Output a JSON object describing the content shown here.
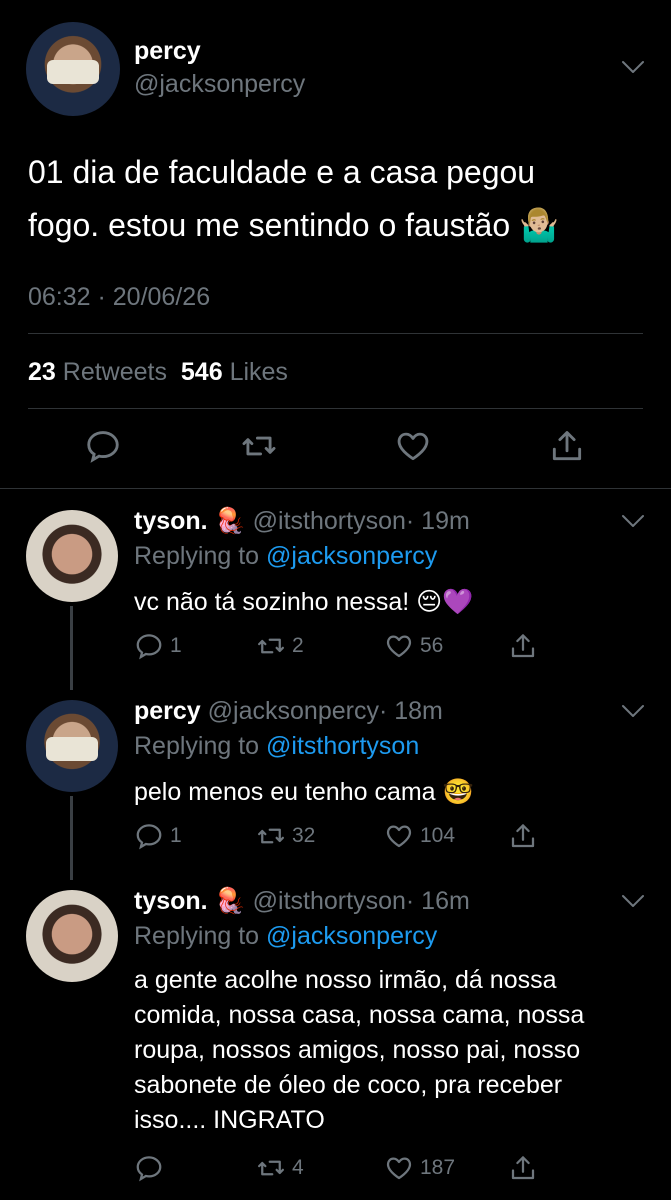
{
  "tweet": {
    "display_name": "percy",
    "handle": "@jacksonpercy",
    "text_line1": "01 dia de faculdade e a casa pegou",
    "text_line2": "fogo. estou me sentindo o faustão",
    "emoji": "🤷🏼‍♂️",
    "timestamp": "06:32 · 20/06/26",
    "retweets_count": "23",
    "retweets_label": "Retweets",
    "likes_count": "546",
    "likes_label": "Likes"
  },
  "replies": [
    {
      "display_name": "tyson.",
      "badge_emoji": "🪼",
      "handle": "@itsthortyson",
      "time": "· 19m",
      "replying_prefix": "Replying to",
      "replying_to": "@jacksonpercy",
      "text": "vc não tá sozinho nessa! 😔💜",
      "replies": "1",
      "retweets": "2",
      "likes": "56"
    },
    {
      "display_name": "percy",
      "handle": "@jacksonpercy",
      "time": "· 18m",
      "replying_prefix": "Replying to",
      "replying_to": "@itsthortyson",
      "text": "pelo menos eu tenho cama 🤓",
      "replies": "1",
      "retweets": "32",
      "likes": "104"
    },
    {
      "display_name": "tyson.",
      "badge_emoji": "🪼",
      "handle": "@itsthortyson",
      "time": "· 16m",
      "replying_prefix": "Replying to",
      "replying_to": "@jacksonpercy",
      "text_lines": [
        "a gente acolhe nosso irmão, dá nossa",
        "comida, nossa casa, nossa cama, nossa",
        "roupa, nossos amigos, nosso pai, nosso",
        "sabonete de óleo de coco, pra receber",
        "isso.... INGRATO"
      ],
      "replies": "",
      "retweets": "4",
      "likes": "187"
    }
  ],
  "colors": {
    "background": "#000000",
    "text": "#ffffff",
    "secondary": "#6e767d",
    "link": "#1d9bf0"
  },
  "icons": [
    "reply-icon",
    "retweet-icon",
    "like-icon",
    "share-icon",
    "chevron-down-icon"
  ]
}
